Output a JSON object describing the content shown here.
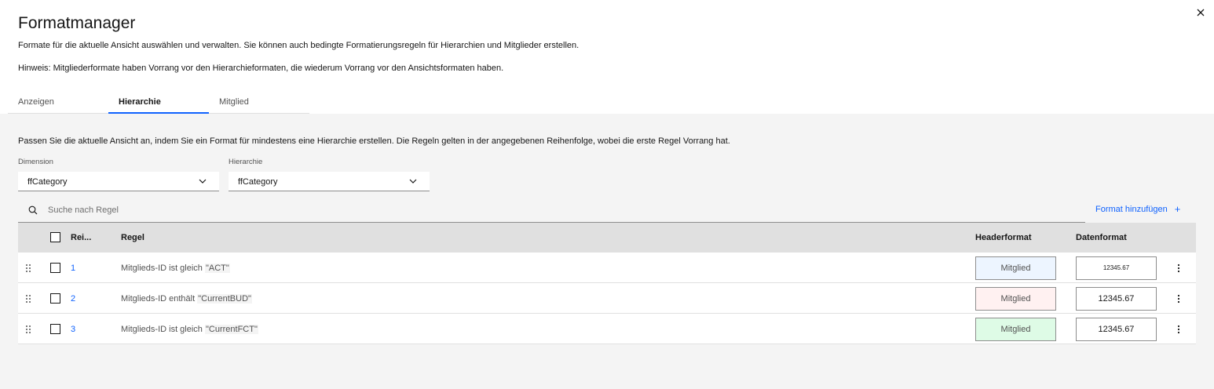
{
  "dialog": {
    "title": "Formatmanager",
    "subtitle": "Formate für die aktuelle Ansicht auswählen und verwalten. Sie können auch bedingte Formatierungsregeln für Hierarchien und Mitglieder erstellen.",
    "hint": "Hinweis: Mitgliederformate haben Vorrang vor den Hierarchieformaten, die wiederum Vorrang vor den Ansichtsformaten haben.",
    "close_icon": "close-icon"
  },
  "tabs": [
    {
      "label": "Anzeigen",
      "active": false
    },
    {
      "label": "Hierarchie",
      "active": true
    },
    {
      "label": "Mitglied",
      "active": false
    }
  ],
  "panel": {
    "description": "Passen Sie die aktuelle Ansicht an, indem Sie ein Format für mindestens eine Hierarchie erstellen. Die Regeln gelten in der angegebenen Reihenfolge, wobei die erste Regel Vorrang hat.",
    "dimension": {
      "label": "Dimension",
      "value": "ffCategory"
    },
    "hierarchy": {
      "label": "Hierarchie",
      "value": "ffCategory"
    },
    "search": {
      "placeholder": "Suche nach Regel"
    },
    "add_format_label": "Format hinzufügen",
    "add_icon": "+"
  },
  "table": {
    "headers": {
      "order": "Rei...",
      "rule": "Regel",
      "header_format": "Headerformat",
      "data_format": "Datenformat"
    },
    "rows": [
      {
        "order": "1",
        "rule_prefix": "Mitglieds-ID ist gleich ",
        "rule_value": "\"ACT\"",
        "header_format": "Mitglied",
        "header_bg": "#edf5ff",
        "data_format": "12345.67",
        "data_small": true
      },
      {
        "order": "2",
        "rule_prefix": "Mitglieds-ID enthält ",
        "rule_value": "\"CurrentBUD\"",
        "header_format": "Mitglied",
        "header_bg": "#fff1f1",
        "data_format": "12345.67",
        "data_small": false
      },
      {
        "order": "3",
        "rule_prefix": "Mitglieds-ID ist gleich ",
        "rule_value": "\"CurrentFCT\"",
        "header_format": "Mitglied",
        "header_bg": "#defbe6",
        "data_format": "12345.67",
        "data_small": false
      }
    ]
  },
  "colors": {
    "accent": "#0f62fe",
    "panel_bg": "#f4f4f4",
    "header_bg": "#e0e0e0"
  }
}
